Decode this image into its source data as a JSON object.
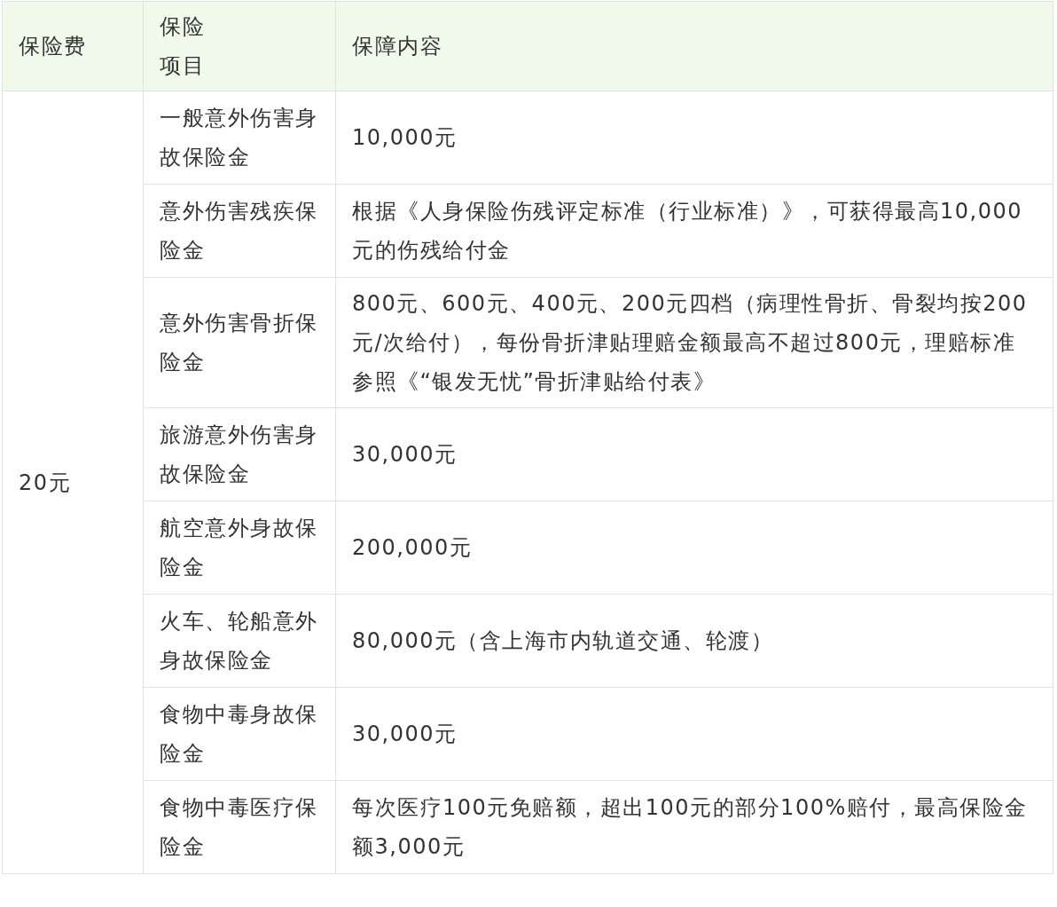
{
  "table": {
    "columns": [
      [
        "保险费"
      ],
      [
        "保险",
        "项目"
      ],
      [
        "保障内容"
      ]
    ],
    "premium": "20元",
    "rows": [
      {
        "item": "一般意外伤害身故保险金",
        "coverage": "10,000元"
      },
      {
        "item": "意外伤害残疾保险金",
        "coverage": "根据《人身保险伤残评定标准（行业标准）》，可获得最高10,000元的伤残给付金"
      },
      {
        "item": "意外伤害骨折保险金",
        "coverage": "800元、600元、400元、200元四档（病理性骨折、骨裂均按200元/次给付），每份骨折津贴理赔金额最高不超过800元，理赔标准参照《“银发无忧”骨折津贴给付表》"
      },
      {
        "item": "旅游意外伤害身故保险金",
        "coverage": "30,000元"
      },
      {
        "item": "航空意外身故保险金",
        "coverage": "200,000元"
      },
      {
        "item": "火车、轮船意外身故保险金",
        "coverage": "80,000元（含上海市内轨道交通、轮渡）"
      },
      {
        "item": "食物中毒身故保险金",
        "coverage": "30,000元"
      },
      {
        "item": "食物中毒医疗保险金",
        "coverage": "每次医疗100元免赔额，超出100元的部分100%赔付，最高保险金额3,000元"
      }
    ]
  }
}
